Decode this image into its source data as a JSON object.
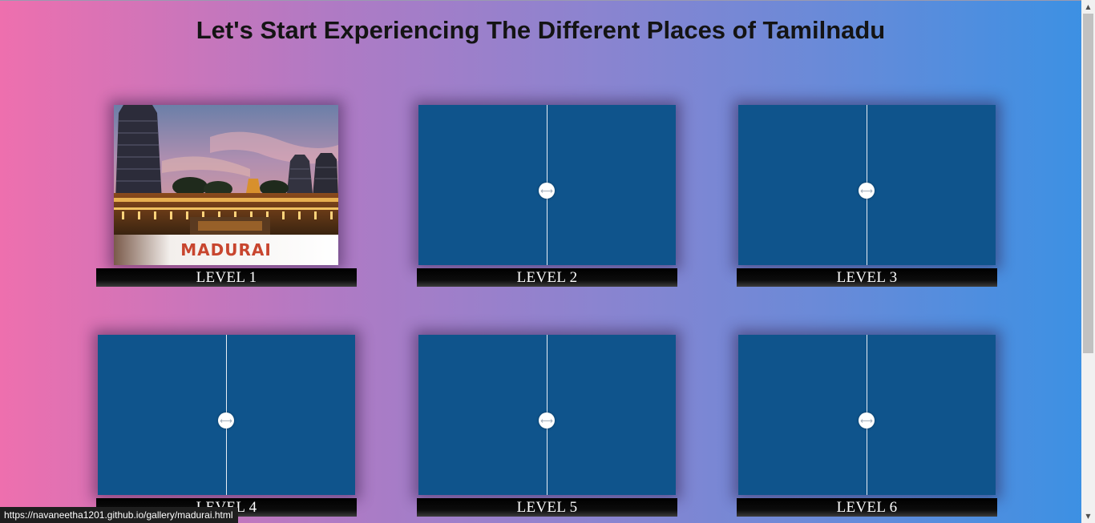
{
  "page": {
    "title": "Let's Start Experiencing The Different Places of Tamilnadu"
  },
  "levels": [
    {
      "label": "LEVEL 1",
      "image_caption": "MADURAI",
      "state": "photo"
    },
    {
      "label": "LEVEL 2",
      "state": "slider",
      "handle_icon": "⟷"
    },
    {
      "label": "LEVEL 3",
      "state": "slider",
      "handle_icon": "⟷"
    },
    {
      "label": "LEVEL 4",
      "state": "slider",
      "handle_icon": "⟷"
    },
    {
      "label": "LEVEL 5",
      "state": "slider",
      "handle_icon": "⟷"
    },
    {
      "label": "LEVEL 6",
      "state": "slider",
      "handle_icon": "⟷"
    }
  ],
  "status_bar": {
    "url": "https://navaneetha1201.github.io/gallery/madurai.html"
  },
  "scrollbar": {
    "up_arrow": "▲",
    "down_arrow": "▼"
  },
  "colors": {
    "gradient_start": "#ee6fae",
    "gradient_end": "#3a91e4",
    "slider_panel": "#0f548c",
    "caption_red": "#c8452e"
  }
}
